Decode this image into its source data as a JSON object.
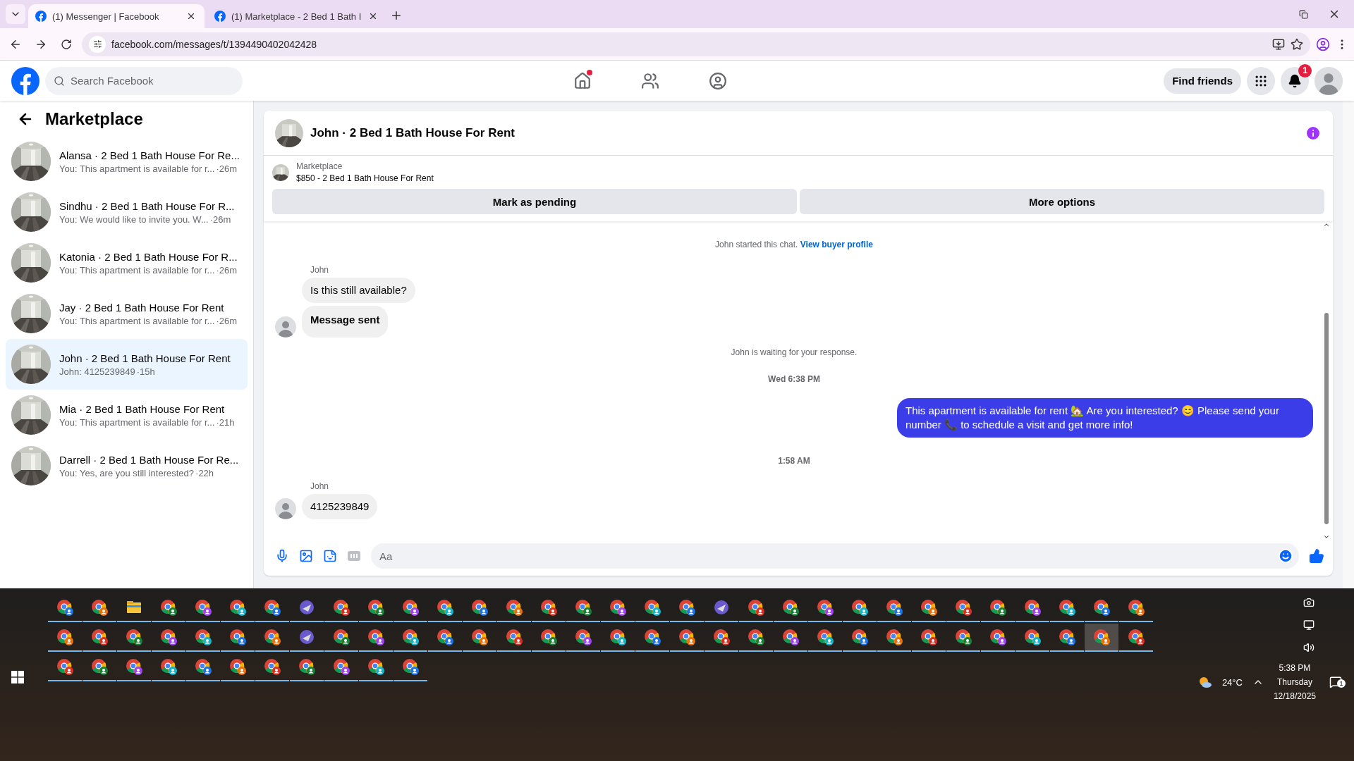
{
  "browser": {
    "tabs": [
      {
        "title": "(1) Messenger | Facebook",
        "selected": true
      },
      {
        "title": "(1) Marketplace - 2 Bed 1 Bath I",
        "selected": false
      }
    ],
    "address": "facebook.com/messages/t/1394490402042428"
  },
  "nav": {
    "search": {
      "placeholder": "Search Facebook"
    },
    "items": [
      {
        "kind": "home",
        "dot": true
      },
      {
        "kind": "friends",
        "dot": false
      },
      {
        "kind": "groups",
        "dot": false
      }
    ],
    "find_friends": "Find friends",
    "notifications": "1"
  },
  "sidebar": {
    "title": "Marketplace",
    "items": [
      {
        "name": "Alansa · 2 Bed 1 Bath House For Re...",
        "preview": "You: This apartment is available for r...",
        "time": "·26m",
        "selected": false
      },
      {
        "name": "Sindhu · 2 Bed 1 Bath House For R...",
        "preview": "You: We would like to invite you. W...",
        "time": "·26m",
        "selected": false
      },
      {
        "name": "Katonia · 2 Bed 1 Bath House For R...",
        "preview": "You: This apartment is available for r...",
        "time": "·26m",
        "selected": false
      },
      {
        "name": "Jay · 2 Bed 1 Bath House For Rent",
        "preview": "You: This apartment is available for r...",
        "time": "·26m",
        "selected": false
      },
      {
        "name": "John · 2 Bed 1 Bath House For Rent",
        "preview": "John: 4125239849",
        "time": "·15h",
        "selected": true
      },
      {
        "name": "Mia · 2 Bed 1 Bath House For Rent",
        "preview": "You: This apartment is available for r...",
        "time": "·21h",
        "selected": false
      },
      {
        "name": "Darrell · 2 Bed 1 Bath House For Re...",
        "preview": "You: Yes, are you still interested?",
        "time": "·22h",
        "selected": false
      }
    ]
  },
  "chat": {
    "title": "John · 2 Bed 1 Bath House For Rent",
    "listing": {
      "label": "Marketplace",
      "title": "$850 - 2 Bed 1 Bath House For Rent"
    },
    "actions": [
      "Mark as pending",
      "More options"
    ],
    "messages": [
      {
        "kind": "system",
        "text": "John started this chat.",
        "link": "View buyer profile"
      },
      {
        "kind": "sender",
        "text": "John"
      },
      {
        "kind": "incoming",
        "text": "Is this still available?",
        "bold": false,
        "avatar": false
      },
      {
        "kind": "incoming",
        "text": "Message sent",
        "bold": true,
        "avatar": true
      },
      {
        "kind": "system",
        "text": "John is waiting for your response."
      },
      {
        "kind": "timestamp",
        "text": "Wed 6:38 PM"
      },
      {
        "kind": "outgoing",
        "text": "This apartment is available for rent 🏡 Are you interested? 😊 Please send your number 📞 to schedule a visit and get more info!"
      },
      {
        "kind": "timestamp",
        "text": "1:58 AM"
      },
      {
        "kind": "sender",
        "text": "John"
      },
      {
        "kind": "incoming",
        "text": "4125239849",
        "bold": false,
        "avatar": true
      }
    ],
    "composer": {
      "placeholder": "Aa"
    }
  },
  "taskbar": {
    "rows": [
      {
        "apps": [
          {
            "kind": "chrome",
            "selected": false
          },
          {
            "kind": "chrome",
            "selected": false
          },
          {
            "kind": "folder",
            "selected": false
          },
          {
            "kind": "chrome",
            "selected": false
          },
          {
            "kind": "chrome",
            "selected": false
          },
          {
            "kind": "chrome",
            "selected": false
          },
          {
            "kind": "chrome",
            "selected": false
          },
          {
            "kind": "app",
            "selected": false
          },
          {
            "kind": "chrome",
            "selected": false
          },
          {
            "kind": "chrome",
            "selected": false
          },
          {
            "kind": "chrome",
            "selected": false
          },
          {
            "kind": "chrome",
            "selected": false
          },
          {
            "kind": "chrome",
            "selected": false
          },
          {
            "kind": "chrome",
            "selected": false
          },
          {
            "kind": "chrome",
            "selected": false
          },
          {
            "kind": "chrome",
            "selected": false
          },
          {
            "kind": "chrome",
            "selected": false
          },
          {
            "kind": "chrome",
            "selected": false
          },
          {
            "kind": "chrome",
            "selected": false
          },
          {
            "kind": "app",
            "selected": false
          },
          {
            "kind": "chrome",
            "selected": false
          },
          {
            "kind": "chrome",
            "selected": false
          },
          {
            "kind": "chrome",
            "selected": false
          },
          {
            "kind": "chrome",
            "selected": false
          },
          {
            "kind": "chrome",
            "selected": false
          },
          {
            "kind": "chrome",
            "selected": false
          },
          {
            "kind": "chrome",
            "selected": false
          },
          {
            "kind": "chrome",
            "selected": false
          },
          {
            "kind": "chrome",
            "selected": false
          },
          {
            "kind": "chrome",
            "selected": false
          },
          {
            "kind": "chrome",
            "selected": false
          },
          {
            "kind": "chrome",
            "selected": false
          }
        ]
      },
      {
        "apps": [
          {
            "kind": "chrome",
            "selected": false
          },
          {
            "kind": "chrome",
            "selected": false
          },
          {
            "kind": "chrome",
            "selected": false
          },
          {
            "kind": "chrome",
            "selected": false
          },
          {
            "kind": "chrome",
            "selected": false
          },
          {
            "kind": "chrome",
            "selected": false
          },
          {
            "kind": "chrome",
            "selected": false
          },
          {
            "kind": "app",
            "selected": false
          },
          {
            "kind": "chrome",
            "selected": false
          },
          {
            "kind": "chrome",
            "selected": false
          },
          {
            "kind": "chrome",
            "selected": false
          },
          {
            "kind": "chrome",
            "selected": false
          },
          {
            "kind": "chrome",
            "selected": false
          },
          {
            "kind": "chrome",
            "selected": false
          },
          {
            "kind": "chrome",
            "selected": false
          },
          {
            "kind": "chrome",
            "selected": false
          },
          {
            "kind": "chrome",
            "selected": false
          },
          {
            "kind": "chrome",
            "selected": false
          },
          {
            "kind": "chrome",
            "selected": false
          },
          {
            "kind": "chrome",
            "selected": false
          },
          {
            "kind": "chrome",
            "selected": false
          },
          {
            "kind": "chrome",
            "selected": false
          },
          {
            "kind": "chrome",
            "selected": false
          },
          {
            "kind": "chrome",
            "selected": false
          },
          {
            "kind": "chrome",
            "selected": false
          },
          {
            "kind": "chrome",
            "selected": false
          },
          {
            "kind": "chrome",
            "selected": false
          },
          {
            "kind": "chrome",
            "selected": false
          },
          {
            "kind": "chrome",
            "selected": false
          },
          {
            "kind": "chrome",
            "selected": false
          },
          {
            "kind": "chrome",
            "selected": true
          },
          {
            "kind": "chrome",
            "selected": false
          }
        ]
      },
      {
        "apps": [
          {
            "kind": "chrome",
            "selected": false
          },
          {
            "kind": "chrome",
            "selected": false
          },
          {
            "kind": "chrome",
            "selected": false
          },
          {
            "kind": "chrome",
            "selected": false
          },
          {
            "kind": "chrome",
            "selected": false
          },
          {
            "kind": "chrome",
            "selected": false
          },
          {
            "kind": "chrome",
            "selected": false
          },
          {
            "kind": "chrome",
            "selected": false
          },
          {
            "kind": "chrome",
            "selected": false
          },
          {
            "kind": "chrome",
            "selected": false
          },
          {
            "kind": "chrome",
            "selected": false
          }
        ]
      }
    ],
    "weather": "24°C",
    "time": "5:38 PM",
    "day": "Thursday",
    "date": "12/18/2025",
    "notifications": "1"
  }
}
